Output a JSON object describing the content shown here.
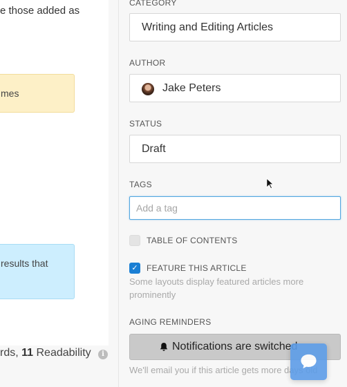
{
  "editor": {
    "text_top": "e those added as",
    "callout_yellow": "mes",
    "callout_blue": "results that",
    "wordcount": {
      "prefix": "rds, ",
      "readability_value": "11",
      "readability_label": " Readability"
    }
  },
  "settings": {
    "category": {
      "label": "CATEGORY",
      "value": "Writing and Editing Articles"
    },
    "author": {
      "label": "AUTHOR",
      "value": "Jake Peters"
    },
    "status": {
      "label": "STATUS",
      "value": "Draft"
    },
    "tags": {
      "label": "TAGS",
      "placeholder": "Add a tag"
    },
    "table_of_contents": {
      "label": "TABLE OF CONTENTS",
      "checked": false
    },
    "feature_article": {
      "label": "FEATURE THIS ARTICLE",
      "checked": true,
      "help": "Some layouts display featured articles more prominently"
    },
    "aging_reminders": {
      "label": "AGING REMINDERS",
      "button_label": "Notifications are switched",
      "help": "We'll email you if this article gets more days old"
    }
  },
  "icons": {
    "info": "info-icon",
    "bell": "bell-icon",
    "chat": "chat-bubble-icon",
    "check": "checkmark-icon",
    "cursor": "mouse-pointer-icon"
  },
  "colors": {
    "accent": "#1a7fd4",
    "focus_border": "#52a7e0",
    "callout_yellow": "#fdf0c7",
    "callout_blue": "#cdeefe",
    "chat_button": "#5d9de8"
  }
}
